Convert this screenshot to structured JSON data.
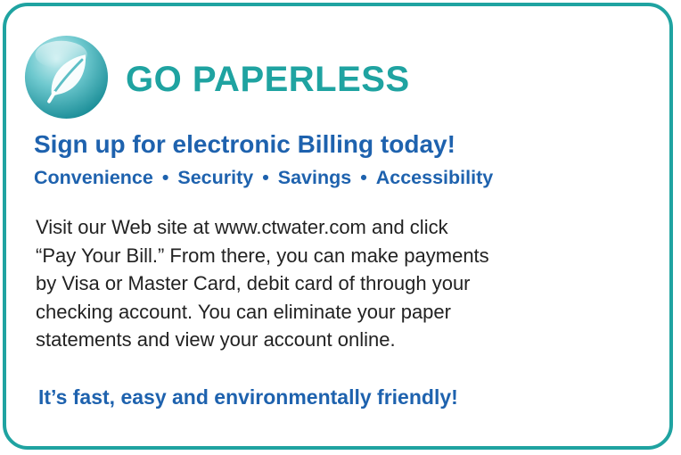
{
  "title": "GO PAPERLESS",
  "subtitle": "Sign up for electronic Billing today!",
  "benefits": [
    "Convenience",
    "Security",
    "Savings",
    "Accessibility"
  ],
  "benefit_separator": "•",
  "body_lines": [
    "Visit our Web site at www.ctwater.com and click",
    "“Pay Your Bill.” From there, you can make payments",
    "by Visa or Master Card, debit card of through your",
    "checking account. You can eliminate your paper",
    "statements and view your account online."
  ],
  "tagline": "It’s fast, easy and environmentally friendly!",
  "logo_icon": "leaf-icon",
  "colors": {
    "border": "#1fa3a1",
    "title": "#1fa3a1",
    "headline": "#1e62ae",
    "body": "#222222"
  }
}
